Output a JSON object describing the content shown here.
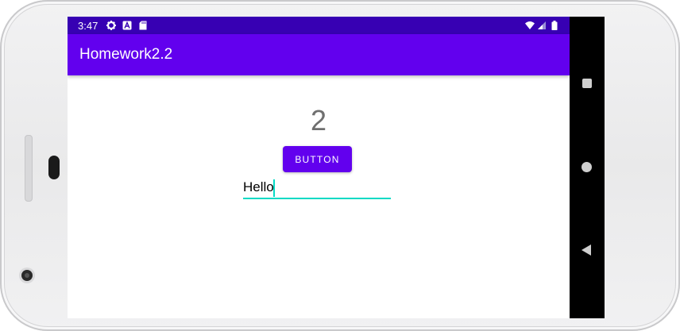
{
  "status_bar": {
    "time": "3:47",
    "icons": [
      "gear-icon",
      "a-notification-icon",
      "sd-card-icon",
      "wifi-icon",
      "signal-icon",
      "battery-icon"
    ]
  },
  "app_bar": {
    "title": "Homework2.2"
  },
  "main": {
    "count_value": "2",
    "button_label": "BUTTON",
    "edit_text_value": "Hello"
  },
  "navigation_bar": {
    "icons": [
      "recents-icon",
      "home-icon",
      "back-icon"
    ]
  },
  "colors": {
    "status_bar": "#3700b3",
    "primary": "#6200ee",
    "accent": "#03dac5",
    "count_text": "#6f6f6f"
  }
}
